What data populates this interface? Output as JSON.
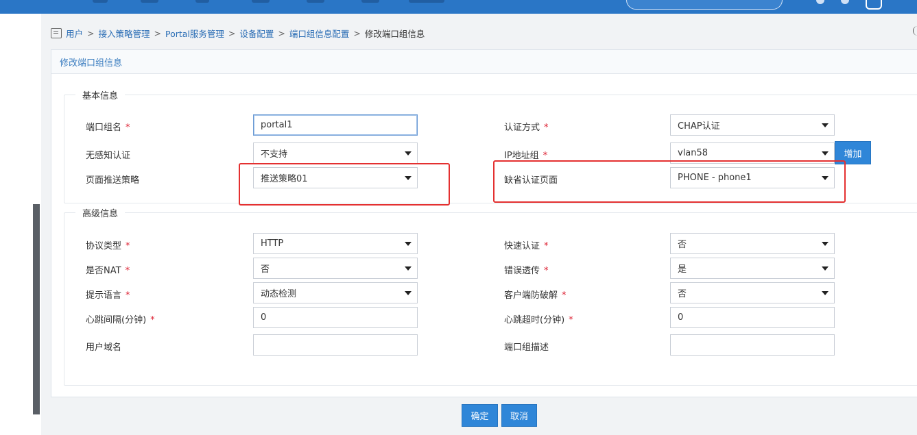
{
  "breadcrumb": {
    "items": [
      "用户",
      "接入策略管理",
      "Portal服务管理",
      "设备配置",
      "端口组信息配置"
    ],
    "separator": ">",
    "current": "修改端口组信息"
  },
  "panel": {
    "title": "修改端口组信息"
  },
  "basic": {
    "legend": "基本信息",
    "port_group_name": {
      "label": "端口组名",
      "value": "portal1"
    },
    "auth_method": {
      "label": "认证方式",
      "value": "CHAP认证"
    },
    "seamless_auth": {
      "label": "无感知认证",
      "value": "不支持"
    },
    "ip_group": {
      "label": "IP地址组",
      "value": "vlan58",
      "add_label": "增加"
    },
    "push_policy": {
      "label": "页面推送策略",
      "value": "推送策略01"
    },
    "default_page": {
      "label": "缺省认证页面",
      "value": "PHONE - phone1"
    }
  },
  "advanced": {
    "legend": "高级信息",
    "protocol": {
      "label": "协议类型",
      "value": "HTTP"
    },
    "fast_auth": {
      "label": "快速认证",
      "value": "否"
    },
    "nat": {
      "label": "是否NAT",
      "value": "否"
    },
    "error_passthrough": {
      "label": "错误透传",
      "value": "是"
    },
    "language": {
      "label": "提示语言",
      "value": "动态检测"
    },
    "anti_crack": {
      "label": "客户端防破解",
      "value": "否"
    },
    "heartbeat_interval": {
      "label": "心跳间隔(分钟)",
      "value": "0"
    },
    "heartbeat_timeout": {
      "label": "心跳超时(分钟)",
      "value": "0"
    },
    "user_domain": {
      "label": "用户域名",
      "value": ""
    },
    "description": {
      "label": "端口组描述",
      "value": ""
    }
  },
  "required_mark": "*",
  "actions": {
    "ok": "确定",
    "cancel": "取消"
  },
  "colors": {
    "accent": "#2f86d8",
    "topbar": "#2a76c6",
    "highlight": "#e43030",
    "required": "#dd2233"
  },
  "icons": {
    "breadcrumb": "user-list-icon",
    "dropdown": "caret-down-icon"
  }
}
